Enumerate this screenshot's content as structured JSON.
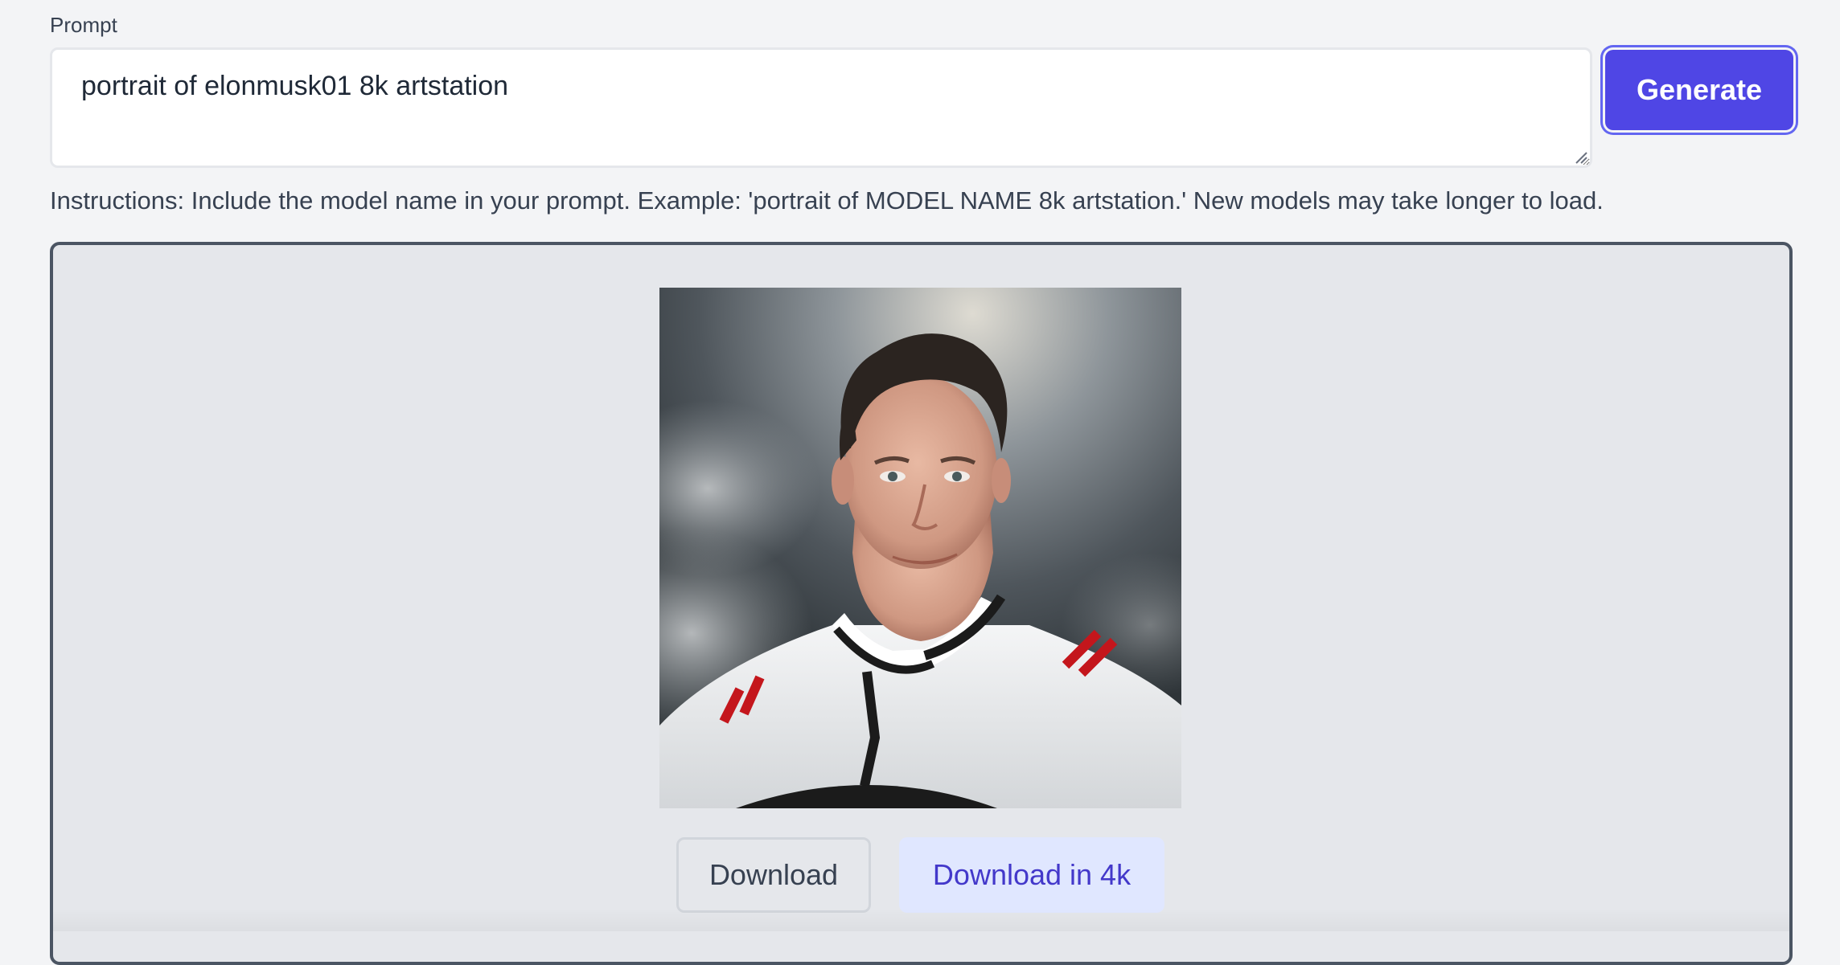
{
  "prompt": {
    "label": "Prompt",
    "value": "portrait of elonmusk01 8k artstation"
  },
  "generate_button": {
    "label": "Generate"
  },
  "instructions": "Instructions: Include the model name in your prompt. Example: 'portrait of MODEL NAME 8k artstation.' New models may take longer to load.",
  "result": {
    "download_label": "Download",
    "download_4k_label": "Download in 4k"
  },
  "colors": {
    "accent": "#4f46e5",
    "accent_light": "#e0e7ff",
    "background": "#f3f4f6",
    "panel": "#e5e7eb"
  },
  "icons": {
    "resize": "resize-grip-icon"
  }
}
